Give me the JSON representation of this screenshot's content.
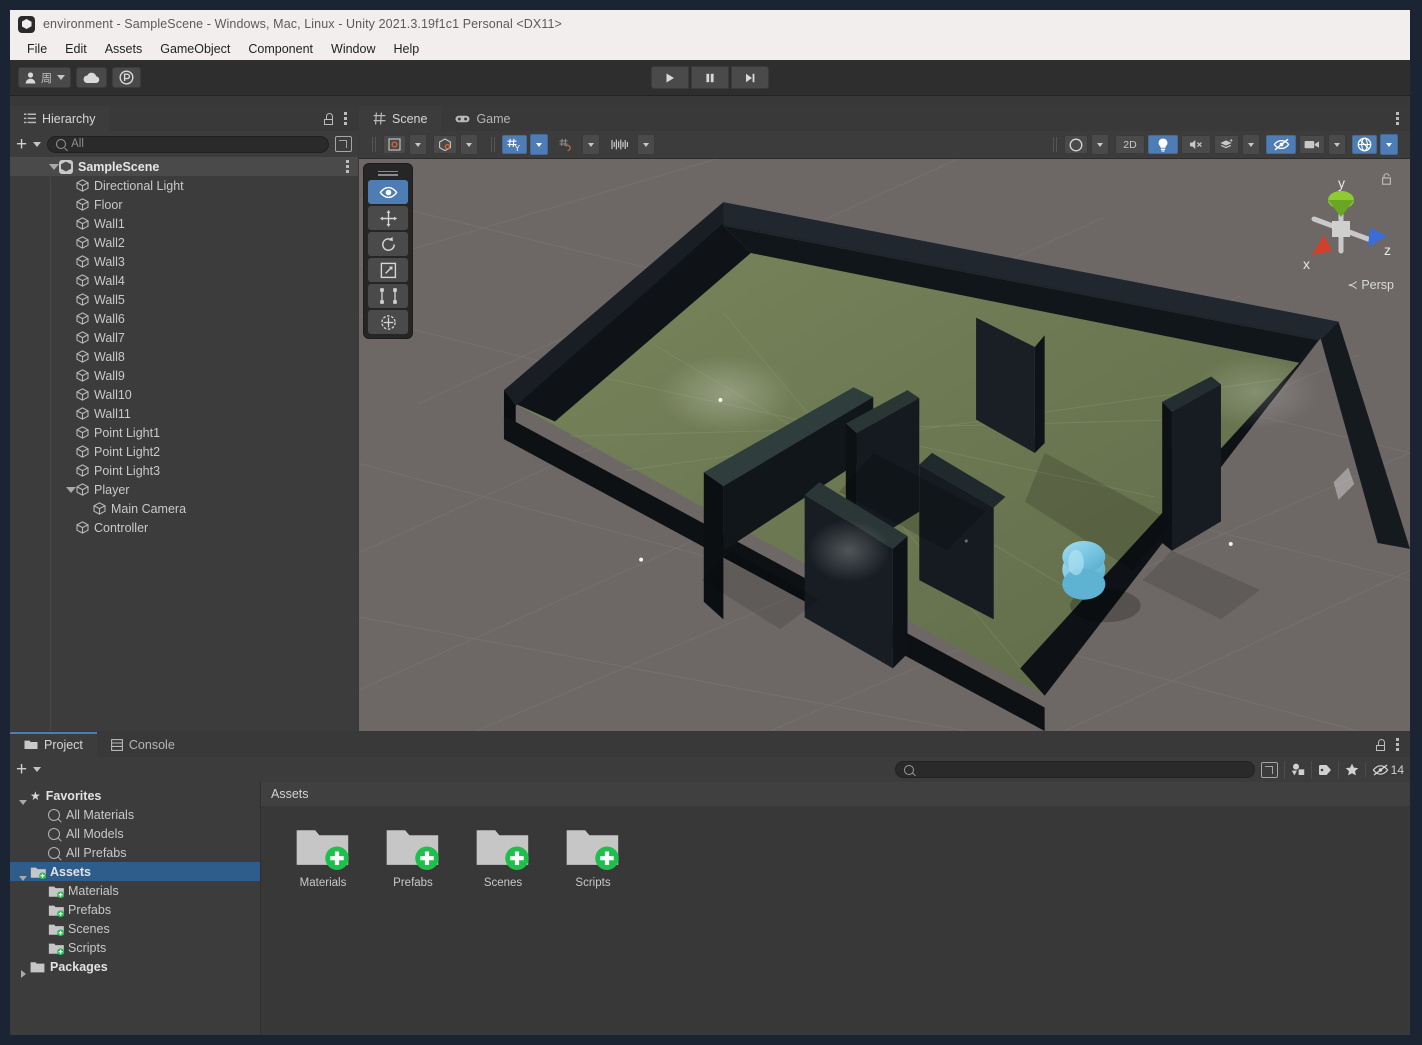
{
  "window": {
    "title": "environment - SampleScene - Windows, Mac, Linux - Unity 2021.3.19f1c1 Personal <DX11>",
    "logo_icon": "unity-logo-icon"
  },
  "menubar": {
    "items": [
      "File",
      "Edit",
      "Assets",
      "GameObject",
      "Component",
      "Window",
      "Help"
    ]
  },
  "toolbar": {
    "account_icon": "account-person-icon",
    "account_label": "周",
    "account_dropdown_icon": "chevron-down-icon",
    "cloud_icon": "cloud-icon",
    "collab_icon": "collab-icon",
    "play_icon": "play-icon",
    "pause_icon": "pause-icon",
    "step_icon": "step-icon"
  },
  "hierarchy": {
    "tab_label": "Hierarchy",
    "tab_icon": "hierarchy-icon",
    "lock_icon": "lock-icon",
    "menu_icon": "kebab-menu-icon",
    "add_icon": "plus-icon",
    "add_dropdown_icon": "chevron-down-icon",
    "search_placeholder": "All",
    "search_icon": "search-icon",
    "search_expand_icon": "expand-search-icon",
    "scene_root": "SampleScene",
    "scene_root_icon": "unity-scene-icon",
    "items": [
      {
        "label": "Directional Light",
        "depth": 1,
        "expandable": false
      },
      {
        "label": "Floor",
        "depth": 1,
        "expandable": false
      },
      {
        "label": "Wall1",
        "depth": 1,
        "expandable": false
      },
      {
        "label": "Wall2",
        "depth": 1,
        "expandable": false
      },
      {
        "label": "Wall3",
        "depth": 1,
        "expandable": false
      },
      {
        "label": "Wall4",
        "depth": 1,
        "expandable": false
      },
      {
        "label": "Wall5",
        "depth": 1,
        "expandable": false
      },
      {
        "label": "Wall6",
        "depth": 1,
        "expandable": false
      },
      {
        "label": "Wall7",
        "depth": 1,
        "expandable": false
      },
      {
        "label": "Wall8",
        "depth": 1,
        "expandable": false
      },
      {
        "label": "Wall9",
        "depth": 1,
        "expandable": false
      },
      {
        "label": "Wall10",
        "depth": 1,
        "expandable": false
      },
      {
        "label": "Wall11",
        "depth": 1,
        "expandable": false
      },
      {
        "label": "Point Light1",
        "depth": 1,
        "expandable": false
      },
      {
        "label": "Point Light2",
        "depth": 1,
        "expandable": false
      },
      {
        "label": "Point Light3",
        "depth": 1,
        "expandable": false
      },
      {
        "label": "Player",
        "depth": 1,
        "expandable": true
      },
      {
        "label": "Main Camera",
        "depth": 2,
        "expandable": false
      },
      {
        "label": "Controller",
        "depth": 1,
        "expandable": false
      }
    ]
  },
  "scene_panel": {
    "tabs": [
      {
        "label": "Scene",
        "icon": "scene-grid-icon",
        "active": true
      },
      {
        "label": "Game",
        "icon": "gamepad-icon",
        "active": false
      }
    ],
    "menu_icon": "kebab-menu-icon",
    "toolbar_left": [
      {
        "name": "pivot-mode-button",
        "icon": "pivot-center-icon",
        "active": false,
        "dropdown": true
      },
      {
        "name": "pivot-rotation-button",
        "icon": "handle-global-icon",
        "active": false,
        "dropdown": true
      },
      {
        "name": "grid-snap-y-button",
        "icon": "grid-axis-y-icon",
        "active": true,
        "dropdown": true
      },
      {
        "name": "grid-snapping-button",
        "icon": "grid-snap-icon",
        "active": false,
        "dropdown": true
      },
      {
        "name": "scene-view-camera-button",
        "icon": "layout-bars-icon",
        "active": false,
        "dropdown": true
      }
    ],
    "toolbar_right": [
      {
        "name": "draw-mode-button",
        "icon": "shading-sphere-icon",
        "active": false,
        "dropdown": true
      },
      {
        "name": "toggle-2d-button",
        "label": "2D",
        "active": false
      },
      {
        "name": "scene-lighting-button",
        "icon": "light-bulb-icon",
        "active": true
      },
      {
        "name": "scene-audio-button",
        "icon": "audio-mute-icon",
        "active": false
      },
      {
        "name": "scene-fx-button",
        "icon": "effects-layers-icon",
        "active": false,
        "dropdown": true
      },
      {
        "name": "hidden-objects-button",
        "icon": "eye-off-icon",
        "active": true
      },
      {
        "name": "scene-camera-button",
        "icon": "camera-icon",
        "active": false,
        "dropdown": true
      },
      {
        "name": "gizmos-button",
        "icon": "gizmos-globe-icon",
        "active": true,
        "dropdown": true
      }
    ],
    "tools_overlay": [
      {
        "name": "view-tool",
        "icon": "eye-hand-icon",
        "active": true
      },
      {
        "name": "move-tool",
        "icon": "move-arrows-icon",
        "active": false
      },
      {
        "name": "rotate-tool",
        "icon": "rotate-icon",
        "active": false
      },
      {
        "name": "scale-tool",
        "icon": "scale-icon",
        "active": false
      },
      {
        "name": "rect-tool",
        "icon": "rect-transform-icon",
        "active": false
      },
      {
        "name": "transform-tool",
        "icon": "transform-globe-icon",
        "active": false
      }
    ],
    "gizmo": {
      "x_label": "x",
      "y_label": "y",
      "z_label": "z",
      "projection_label": "Persp",
      "projection_icon": "chevron-left-icon",
      "x_color": "#d0402c",
      "y_color": "#8ecb32",
      "z_color": "#3a6dd9",
      "lock_icon": "lock-icon"
    },
    "viewport": {
      "background_color": "#6d6866",
      "floor_color": "#6f7a52",
      "wall_color": "#151a1e",
      "player_color": "#7ec8e3"
    }
  },
  "project": {
    "tabs": [
      {
        "label": "Project",
        "icon": "folder-icon",
        "active": true
      },
      {
        "label": "Console",
        "icon": "console-icon",
        "active": false
      }
    ],
    "lock_icon": "lock-icon",
    "menu_icon": "kebab-menu-icon",
    "add_icon": "plus-icon",
    "add_dropdown_icon": "chevron-down-icon",
    "search_placeholder": "",
    "search_icon": "search-icon",
    "search_expand_icon": "expand-search-icon",
    "filters": [
      {
        "name": "filter-by-type-button",
        "icon": "type-filter-icon"
      },
      {
        "name": "filter-by-label-button",
        "icon": "label-tag-icon"
      },
      {
        "name": "filter-by-favorite-button",
        "icon": "star-icon"
      }
    ],
    "icon_size_label": "14",
    "icon_size_icon": "eye-off-icon",
    "tree": [
      {
        "label": "Favorites",
        "depth": 0,
        "icon": "star-icon",
        "expanded": true,
        "bold": true,
        "selected": false
      },
      {
        "label": "All Materials",
        "depth": 1,
        "icon": "search-icon",
        "selected": false
      },
      {
        "label": "All Models",
        "depth": 1,
        "icon": "search-icon",
        "selected": false
      },
      {
        "label": "All Prefabs",
        "depth": 1,
        "icon": "search-icon",
        "selected": false
      },
      {
        "label": "Assets",
        "depth": 0,
        "icon": "folder-plus-icon",
        "expanded": true,
        "bold": true,
        "selected": true
      },
      {
        "label": "Materials",
        "depth": 1,
        "icon": "folder-plus-icon",
        "selected": false
      },
      {
        "label": "Prefabs",
        "depth": 1,
        "icon": "folder-plus-icon",
        "selected": false
      },
      {
        "label": "Scenes",
        "depth": 1,
        "icon": "folder-plus-icon",
        "selected": false
      },
      {
        "label": "Scripts",
        "depth": 1,
        "icon": "folder-plus-icon",
        "selected": false
      },
      {
        "label": "Packages",
        "depth": 0,
        "icon": "folder-icon",
        "expanded": false,
        "bold": true,
        "selected": false
      }
    ],
    "breadcrumb": "Assets",
    "grid_items": [
      {
        "label": "Materials",
        "icon": "folder-plus-icon"
      },
      {
        "label": "Prefabs",
        "icon": "folder-plus-icon"
      },
      {
        "label": "Scenes",
        "icon": "folder-plus-icon"
      },
      {
        "label": "Scripts",
        "icon": "folder-plus-icon"
      }
    ]
  },
  "colors": {
    "accent_blue": "#4e7cb5",
    "selection_blue": "#2e5d8c",
    "panel_bg": "#3c3c3c",
    "toolbar_bg": "#2e2e2e",
    "badge_green": "#1fbf4b"
  }
}
